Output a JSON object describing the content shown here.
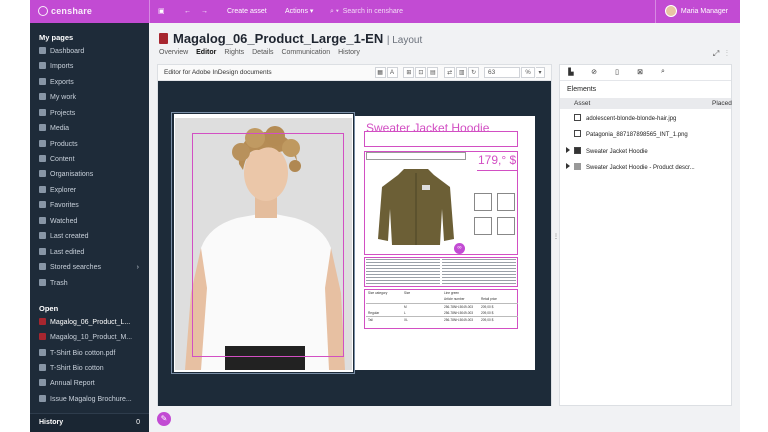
{
  "topbar": {
    "logo": "censhare",
    "create_asset": "Create asset",
    "actions": "Actions ▾",
    "search_placeholder": "Search in censhare",
    "user": "Maria Manager"
  },
  "sidebar": {
    "my_pages_heading": "My pages",
    "my_pages": [
      {
        "label": "Dashboard"
      },
      {
        "label": "Imports"
      },
      {
        "label": "Exports"
      },
      {
        "label": "My work"
      },
      {
        "label": "Projects"
      },
      {
        "label": "Media"
      },
      {
        "label": "Products"
      },
      {
        "label": "Content"
      },
      {
        "label": "Organisations"
      },
      {
        "label": "Explorer"
      },
      {
        "label": "Favorites"
      },
      {
        "label": "Watched"
      },
      {
        "label": "Last created"
      },
      {
        "label": "Last edited"
      },
      {
        "label": "Stored searches"
      },
      {
        "label": "Trash"
      }
    ],
    "open_heading": "Open",
    "open": [
      {
        "label": "Magalog_06_Product_L..."
      },
      {
        "label": "Magalog_10_Product_M..."
      },
      {
        "label": "T-Shirt Bio cotton.pdf"
      },
      {
        "label": "T-Shirt Bio cotton"
      },
      {
        "label": "Annual Report"
      },
      {
        "label": "Issue Magalog Brochure..."
      }
    ],
    "history_label": "History",
    "history_count": "0"
  },
  "main": {
    "title": "Magalog_06_Product_Large_1-EN",
    "title_suffix": "| Layout",
    "tabs": [
      "Overview",
      "Editor",
      "Rights",
      "Details",
      "Communication",
      "History"
    ],
    "active_tab": "Editor"
  },
  "editor": {
    "header": "Editor for Adobe InDesign documents",
    "zoom": "63",
    "zoom_unit": "%",
    "layout_title": "Sweater Jacket Hoodie",
    "price": "179,° $",
    "table": {
      "col1": "Size category",
      "col2": "Size",
      "col3": "Line green",
      "col3b": "Article number",
      "col4": "Retail price",
      "rows": [
        {
          "cat": "",
          "size": "M",
          "art": "256-78NH-5049-003",
          "price": "209,00 $"
        },
        {
          "cat": "Regular",
          "size": "L",
          "art": "256-78NH-5049-003",
          "price": "209,00 $"
        },
        {
          "cat": "Tall",
          "size": "XL",
          "art": "256-78NH-5049-003",
          "price": "209,00 $"
        }
      ]
    }
  },
  "panel": {
    "title": "Elements",
    "col_asset": "Asset",
    "col_placed": "Placed",
    "rows": [
      {
        "label": "adolescent-blonde-blonde-hair.jpg"
      },
      {
        "label": "Patagonia_887187898565_INT_1.png"
      },
      {
        "label": "Sweater Jacket Hoodie"
      },
      {
        "label": "Sweater Jacket Hoodie - Product descr..."
      }
    ]
  },
  "colors": {
    "accent": "#c24bd3",
    "sidebar": "#1e2b39",
    "canvas": "#1d2b39"
  }
}
